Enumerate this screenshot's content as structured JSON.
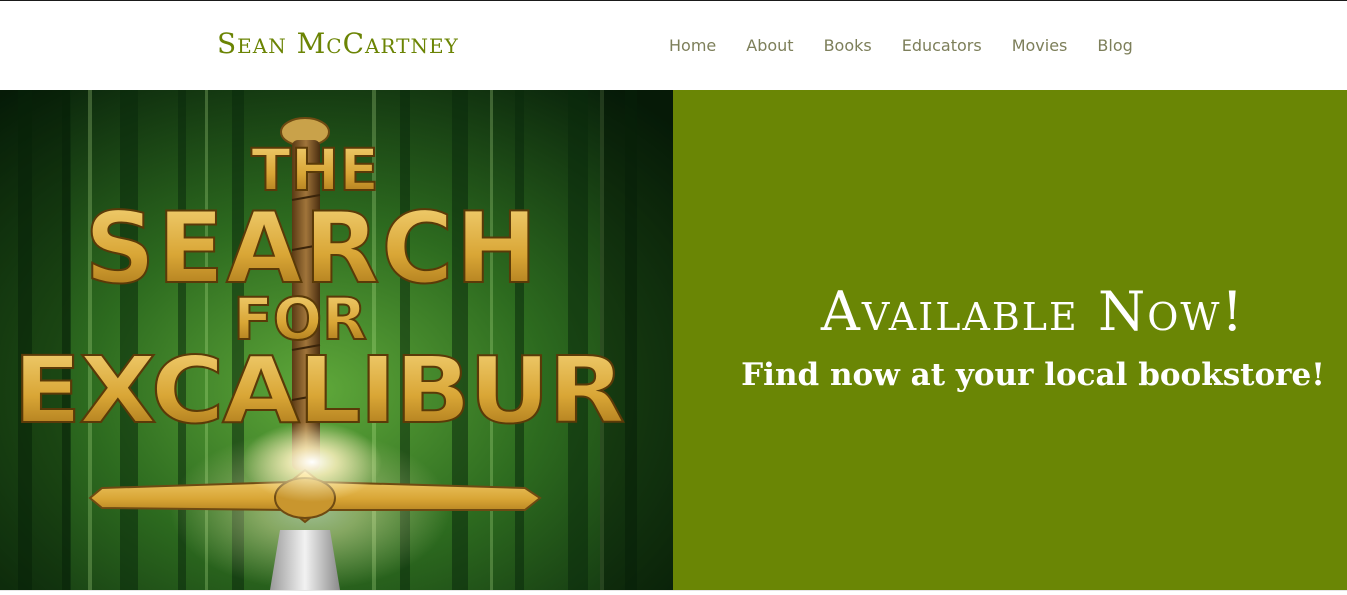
{
  "header": {
    "site_title": "Sean McCartney"
  },
  "nav": {
    "items": [
      {
        "label": "Home"
      },
      {
        "label": "About"
      },
      {
        "label": "Books"
      },
      {
        "label": "Educators"
      },
      {
        "label": "Movies"
      },
      {
        "label": "Blog"
      }
    ]
  },
  "hero": {
    "cover": {
      "line1": "THE",
      "line2": "SEARCH",
      "line3": "FOR",
      "line4": "EXCALIBUR"
    },
    "heading": "Available Now!",
    "subheading": "Find now at your local bookstore!"
  },
  "colors": {
    "brand_green": "#6b8404",
    "promo_background": "#6a8605",
    "nav_text": "#7d7f5a",
    "cover_gold": "#e0b84a"
  },
  "icons": [
    "sword-hilt-icon"
  ]
}
